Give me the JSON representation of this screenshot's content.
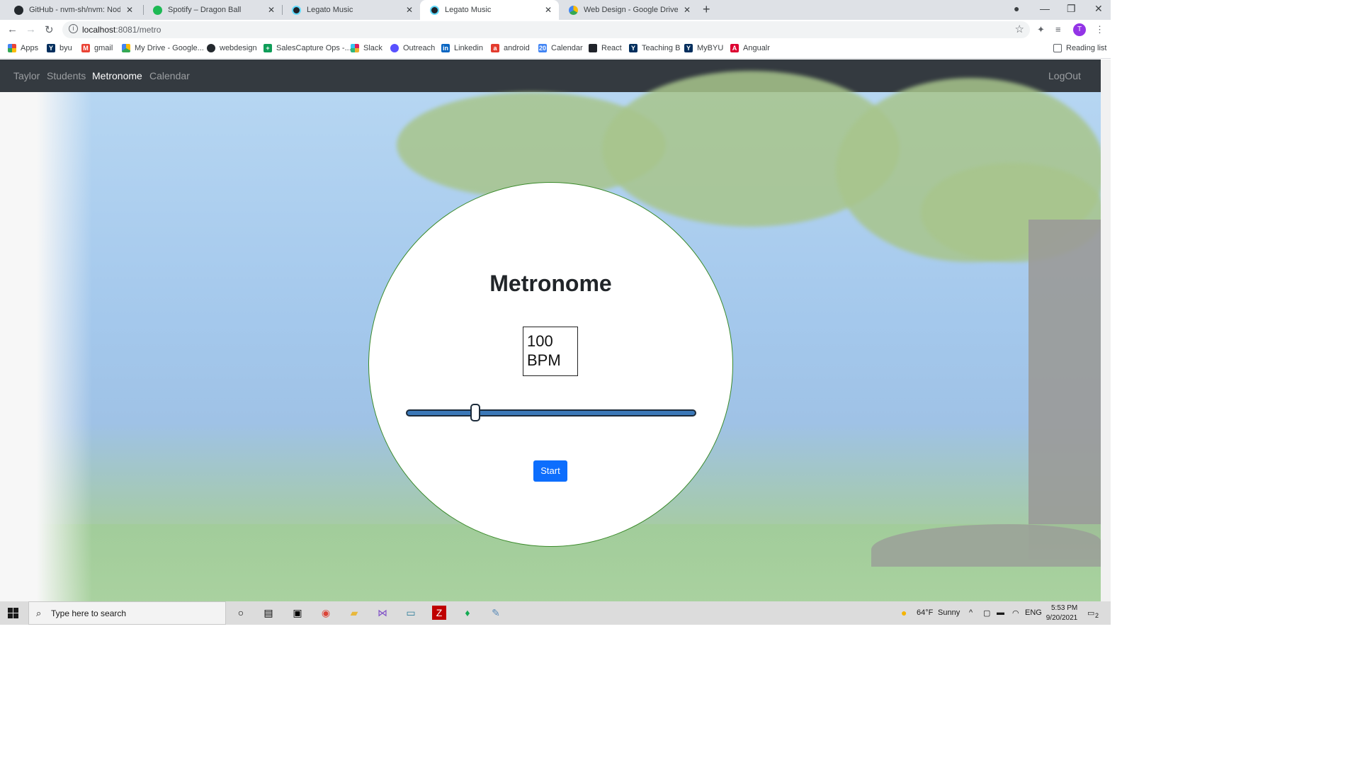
{
  "browser": {
    "tabs": [
      {
        "title": "GitHub - nvm-sh/nvm: Node Ver",
        "icon": "github-icon"
      },
      {
        "title": "Spotify – Dragon Ball",
        "icon": "spotify-icon"
      },
      {
        "title": "Legato Music",
        "icon": "react-icon"
      },
      {
        "title": "Legato Music",
        "icon": "react-icon"
      },
      {
        "title": "Web Design - Google Drive",
        "icon": "google-drive-icon"
      }
    ],
    "url_host": "localhost",
    "url_rest": ":8081/metro",
    "avatar_letter": "T",
    "bookmarks": [
      {
        "label": "Apps"
      },
      {
        "label": "byu"
      },
      {
        "label": "gmail"
      },
      {
        "label": "My Drive - Google..."
      },
      {
        "label": "webdesign"
      },
      {
        "label": "SalesCapture Ops -..."
      },
      {
        "label": "Slack"
      },
      {
        "label": "Outreach"
      },
      {
        "label": "Linkedin"
      },
      {
        "label": "android"
      },
      {
        "label": "Calendar"
      },
      {
        "label": "React"
      },
      {
        "label": "Teaching B"
      },
      {
        "label": "MyBYU"
      },
      {
        "label": "Angualr"
      }
    ],
    "reading_list": "Reading list"
  },
  "app": {
    "nav": {
      "brand": "Taylor",
      "students": "Students",
      "metronome": "Metronome",
      "calendar": "Calendar",
      "logout": "LogOut"
    },
    "metronome": {
      "title": "Metronome",
      "bpm_value": "100",
      "bpm_unit": "BPM",
      "slider_fraction": 0.23,
      "start_label": "Start"
    }
  },
  "taskbar": {
    "search_placeholder": "Type here to search",
    "weather_temp": "64°F",
    "weather_text": "Sunny",
    "language": "ENG",
    "time": "5:53 PM",
    "date": "9/20/2021",
    "notification_count": "2"
  },
  "colors": {
    "navbar": "#343a40",
    "primary_button": "#0d6efd",
    "circle_border": "#3a8a2a",
    "slider_track": "#3b78b8"
  }
}
